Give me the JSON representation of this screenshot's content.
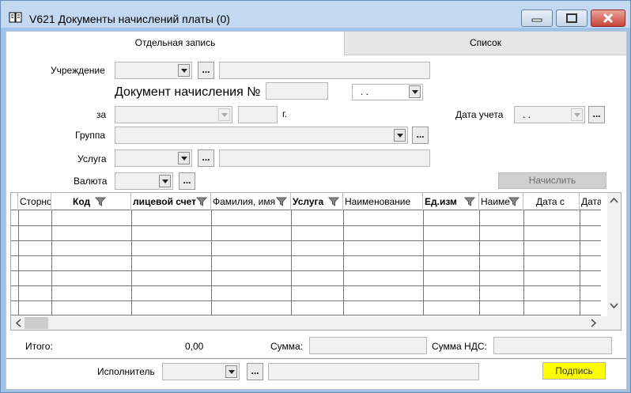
{
  "window": {
    "title": "V621 Документы начислений платы (0)"
  },
  "tabs": [
    {
      "label": "Отдельная запись",
      "active": true
    },
    {
      "label": "Список",
      "active": false
    }
  ],
  "form": {
    "institution_label": "Учреждение",
    "doc_title": "Документ начисления №",
    "doc_number": "",
    "doc_date": " .  .",
    "period_label": "за",
    "year_suffix": "г.",
    "account_date_label": "Дата учета",
    "account_date": " .  .",
    "group_label": "Группа",
    "service_label": "Услуга",
    "currency_label": "Валюта",
    "browse_label": "...",
    "calculate_label": "Начислить"
  },
  "table": {
    "columns": [
      {
        "label": "Сторно",
        "bold": false,
        "filter": false
      },
      {
        "label": "Код",
        "bold": true,
        "filter": true
      },
      {
        "label": "лицевой счет",
        "bold": true,
        "filter": true
      },
      {
        "label": "Фамилия, имя",
        "bold": false,
        "filter": true
      },
      {
        "label": "Услуга",
        "bold": true,
        "filter": true
      },
      {
        "label": "Наименование",
        "bold": false,
        "filter": false
      },
      {
        "label": "Ед.изм",
        "bold": true,
        "filter": true
      },
      {
        "label": "Наиме",
        "bold": false,
        "filter": true
      },
      {
        "label": "Дата с",
        "bold": false,
        "filter": false
      },
      {
        "label": "Дата",
        "bold": false,
        "filter": false
      }
    ],
    "row_count": 7
  },
  "totals": {
    "total_label": "Итого:",
    "total_value": "0,00",
    "sum_label": "Сумма:",
    "vat_label": "Сумма НДС:"
  },
  "footer": {
    "executor_label": "Исполнитель",
    "sign_label": "Подпись"
  },
  "colors": {
    "sign_button": "#ffff00",
    "frame": "#9fc3e7"
  }
}
